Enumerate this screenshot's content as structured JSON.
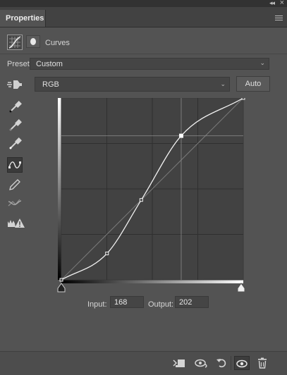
{
  "panel": {
    "tab_label": "Properties"
  },
  "header": {
    "adjustment_title": "Curves"
  },
  "preset": {
    "label": "Preset:",
    "value": "Custom"
  },
  "channel": {
    "value": "RGB"
  },
  "auto_label": "Auto",
  "curve": {
    "points": [
      [
        0,
        0
      ],
      [
        64,
        37
      ],
      [
        112,
        112
      ],
      [
        168,
        202
      ],
      [
        255,
        255
      ]
    ],
    "grid_divisions": 4,
    "selected_point": {
      "input": 168,
      "output": 202
    }
  },
  "readout": {
    "input_label": "Input:",
    "input_value": "168",
    "output_label": "Output:",
    "output_value": "202"
  },
  "colors": {
    "panel_bg": "#535353",
    "graph_bg": "#424242",
    "curve": "#f2f2f2"
  }
}
